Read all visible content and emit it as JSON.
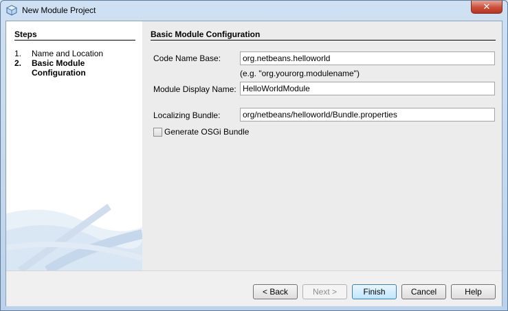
{
  "window": {
    "title": "New Module Project",
    "close_label": "✕"
  },
  "steps": {
    "title": "Steps",
    "items": [
      {
        "number": "1.",
        "label": "Name and Location"
      },
      {
        "number": "2.",
        "label": "Basic Module Configuration"
      }
    ]
  },
  "main": {
    "title": "Basic Module Configuration",
    "code_name_base": {
      "label": "Code Name Base:",
      "value": "org.netbeans.helloworld",
      "hint": "(e.g. \"org.yourorg.modulename\")"
    },
    "display_name": {
      "label": "Module Display Name:",
      "value": "HelloWorldModule"
    },
    "localizing_bundle": {
      "label": "Localizing Bundle:",
      "value": "org/netbeans/helloworld/Bundle.properties"
    },
    "osgi": {
      "label": "Generate OSGi Bundle",
      "checked": false
    }
  },
  "buttons": {
    "back": "< Back",
    "next": "Next >",
    "finish": "Finish",
    "cancel": "Cancel",
    "help": "Help"
  },
  "icons": {
    "app": "netbeans-cube-icon",
    "close": "close-icon"
  }
}
